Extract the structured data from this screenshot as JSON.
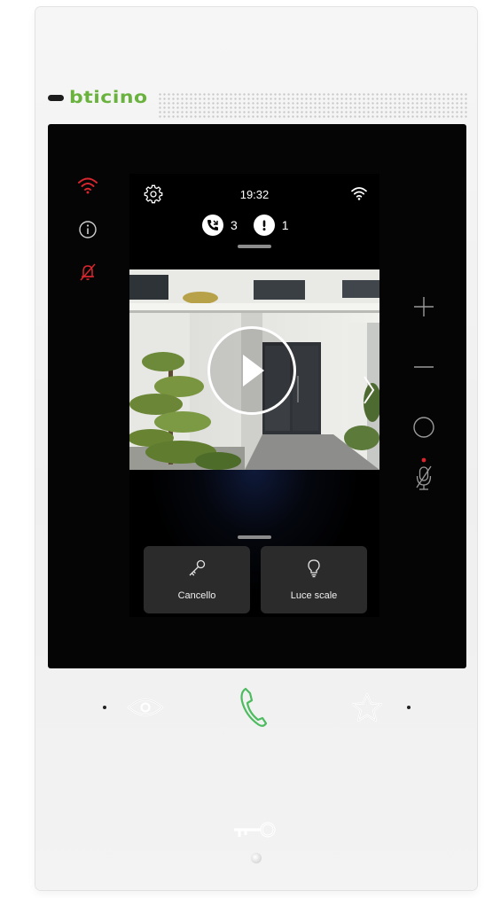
{
  "brand": {
    "name": "bticino"
  },
  "screen": {
    "status_bar": {
      "time": "19:32",
      "icons": [
        "gear-icon",
        "wifi-icon"
      ]
    },
    "notifications": {
      "missed_calls_count": "3",
      "alerts_count": "1"
    },
    "video": {
      "play_icon": "play-icon",
      "next_icon": "chevron-right-icon"
    },
    "actions": [
      {
        "label": "Cancello",
        "icon": "key-icon"
      },
      {
        "label": "Luce scale",
        "icon": "lightbulb-icon"
      }
    ]
  },
  "device_status_icons": [
    "wifi-icon",
    "info-icon",
    "bell-muted-icon"
  ],
  "side_controls": [
    "plus-icon",
    "minus-icon",
    "circle-icon",
    "mic-muted-icon"
  ],
  "bottom_controls": [
    "eye-icon",
    "phone-icon",
    "star-icon"
  ],
  "door_button": "key-icon",
  "colors": {
    "accent_green": "#4dbb5f",
    "status_red": "#d8262e",
    "brand_green": "#6ab23e",
    "screen_background": "#000000",
    "tile_background": "#2b2b2b"
  }
}
